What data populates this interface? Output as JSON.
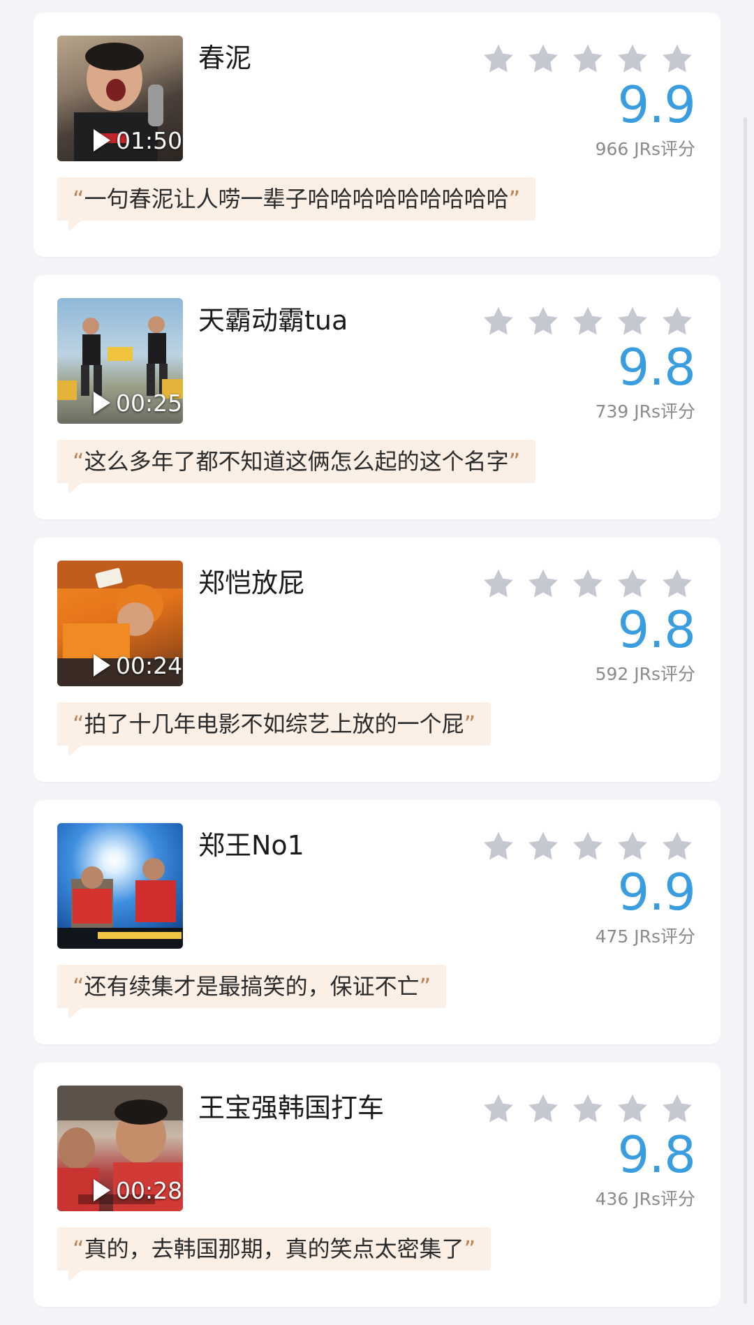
{
  "colors": {
    "score": "#3a9de0",
    "star": "#c4c8d0",
    "quote_bg": "#fbefe6",
    "quote_mark": "#b8835a"
  },
  "items": [
    {
      "title": "春泥",
      "duration": "01:50",
      "has_play": true,
      "rating_stars": 5,
      "score": "9.9",
      "votes": "966 JRs评分",
      "quote": "一句春泥让人唠一辈子哈哈哈哈哈哈哈哈哈"
    },
    {
      "title": "天霸动霸tua",
      "duration": "00:25",
      "has_play": true,
      "rating_stars": 5,
      "score": "9.8",
      "votes": "739 JRs评分",
      "quote": "这么多年了都不知道这俩怎么起的这个名字"
    },
    {
      "title": "郑恺放屁",
      "duration": "00:24",
      "has_play": true,
      "rating_stars": 5,
      "score": "9.8",
      "votes": "592 JRs评分",
      "quote": "拍了十几年电影不如综艺上放的一个屁"
    },
    {
      "title": "郑王No1",
      "duration": "",
      "has_play": false,
      "rating_stars": 5,
      "score": "9.9",
      "votes": "475 JRs评分",
      "quote": "还有续集才是最搞笑的，保证不亡"
    },
    {
      "title": "王宝强韩国打车",
      "duration": "00:28",
      "has_play": true,
      "rating_stars": 5,
      "score": "9.8",
      "votes": "436 JRs评分",
      "quote": "真的，去韩国那期，真的笑点太密集了"
    }
  ],
  "quote_marks": {
    "open": "“",
    "close": "”"
  }
}
